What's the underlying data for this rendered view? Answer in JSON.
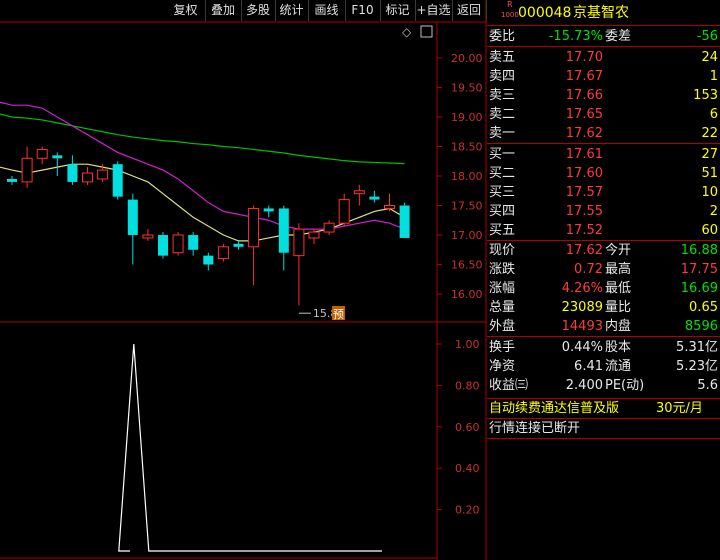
{
  "toolbar": {
    "buttons": [
      "复权",
      "叠加",
      "多股",
      "统计",
      "画线",
      "F10",
      "标记",
      "+自选",
      "返回"
    ]
  },
  "chart": {
    "price_ticks": [
      "20.00",
      "19.50",
      "19.00",
      "18.50",
      "18.00",
      "17.50",
      "17.00",
      "16.50",
      "16.00"
    ],
    "low_label": "15.81",
    "pre_badge": "预",
    "indicator_ticks": [
      "1.00",
      "0.80",
      "0.60",
      "0.40",
      "0.20"
    ],
    "diamond": "◇"
  },
  "chart_data": {
    "type": "candlestick",
    "price_axis": {
      "min": 15.81,
      "max": 20.0,
      "ticks": [
        20.0,
        19.5,
        19.0,
        18.5,
        18.0,
        17.5,
        17.0,
        16.5,
        16.0
      ]
    },
    "candles": [
      {
        "o": 17.95,
        "h": 18.0,
        "l": 17.85,
        "c": 17.9
      },
      {
        "o": 17.9,
        "h": 18.5,
        "l": 17.8,
        "c": 18.3
      },
      {
        "o": 18.3,
        "h": 18.5,
        "l": 18.2,
        "c": 18.45
      },
      {
        "o": 18.35,
        "h": 18.4,
        "l": 18.0,
        "c": 18.3
      },
      {
        "o": 18.2,
        "h": 18.35,
        "l": 17.85,
        "c": 17.9
      },
      {
        "o": 17.9,
        "h": 18.15,
        "l": 17.85,
        "c": 18.05
      },
      {
        "o": 17.95,
        "h": 18.2,
        "l": 17.9,
        "c": 18.1
      },
      {
        "o": 18.2,
        "h": 18.25,
        "l": 17.6,
        "c": 17.65
      },
      {
        "o": 17.6,
        "h": 17.7,
        "l": 16.5,
        "c": 17.0
      },
      {
        "o": 16.95,
        "h": 17.1,
        "l": 16.9,
        "c": 17.0
      },
      {
        "o": 17.0,
        "h": 17.05,
        "l": 16.6,
        "c": 16.65
      },
      {
        "o": 16.7,
        "h": 17.05,
        "l": 16.65,
        "c": 17.0
      },
      {
        "o": 17.0,
        "h": 17.05,
        "l": 16.65,
        "c": 16.75
      },
      {
        "o": 16.65,
        "h": 16.7,
        "l": 16.4,
        "c": 16.5
      },
      {
        "o": 16.6,
        "h": 16.85,
        "l": 16.55,
        "c": 16.8
      },
      {
        "o": 16.85,
        "h": 16.9,
        "l": 16.75,
        "c": 16.8
      },
      {
        "o": 16.8,
        "h": 17.5,
        "l": 16.15,
        "c": 17.45
      },
      {
        "o": 17.45,
        "h": 17.5,
        "l": 17.3,
        "c": 17.4
      },
      {
        "o": 17.45,
        "h": 17.5,
        "l": 16.4,
        "c": 16.7
      },
      {
        "o": 16.65,
        "h": 17.2,
        "l": 15.81,
        "c": 17.1
      },
      {
        "o": 16.95,
        "h": 17.1,
        "l": 16.85,
        "c": 17.05
      },
      {
        "o": 17.05,
        "h": 17.25,
        "l": 17.0,
        "c": 17.2
      },
      {
        "o": 17.2,
        "h": 17.7,
        "l": 17.15,
        "c": 17.6
      },
      {
        "o": 17.7,
        "h": 17.85,
        "l": 17.5,
        "c": 17.75
      },
      {
        "o": 17.65,
        "h": 17.75,
        "l": 17.55,
        "c": 17.6
      },
      {
        "o": 17.45,
        "h": 17.7,
        "l": 17.4,
        "c": 17.5
      },
      {
        "o": 17.5,
        "h": 17.55,
        "l": 16.95,
        "c": 16.95
      }
    ],
    "ma_fast": [
      18.1,
      18.05,
      18.1,
      18.15,
      18.2,
      18.2,
      18.15,
      18.1,
      18.0,
      17.9,
      17.7,
      17.5,
      17.3,
      17.15,
      17.0,
      16.9,
      16.9,
      16.95,
      17.0,
      17.0,
      17.05,
      17.1,
      17.2,
      17.3,
      17.4,
      17.45,
      17.3
    ],
    "ma_mid": [
      19.2,
      19.2,
      19.15,
      19.0,
      18.85,
      18.7,
      18.55,
      18.4,
      18.3,
      18.2,
      18.1,
      17.95,
      17.75,
      17.55,
      17.4,
      17.35,
      17.3,
      17.25,
      17.15,
      17.1,
      17.1,
      17.1,
      17.15,
      17.2,
      17.25,
      17.2,
      17.1
    ],
    "ma_slow": [
      19.0,
      18.98,
      18.95,
      18.9,
      18.85,
      18.8,
      18.75,
      18.7,
      18.66,
      18.63,
      18.6,
      18.58,
      18.55,
      18.53,
      18.5,
      18.48,
      18.45,
      18.42,
      18.39,
      18.35,
      18.32,
      18.29,
      18.26,
      18.24,
      18.23,
      18.22,
      18.21
    ],
    "indicator": {
      "min": 0,
      "max": 1.0,
      "ticks": [
        1.0,
        0.8,
        0.6,
        0.4,
        0.2
      ],
      "values": [
        0,
        0,
        0,
        0,
        0,
        0,
        0,
        0,
        0,
        0,
        0,
        0,
        0,
        0,
        0,
        0,
        0,
        0,
        0,
        0,
        0,
        0,
        0,
        0,
        0,
        0,
        0
      ],
      "spike_index": 8,
      "spike_value": 1.0
    }
  },
  "stock": {
    "code": "000048",
    "name": "京基智农",
    "badge_top": "R",
    "badge_bottom": "1000"
  },
  "order_book": {
    "weibi_label": "委比",
    "weibi_value": "-15.73%",
    "weicha_label": "委差",
    "weicha_value": "-56",
    "asks": [
      {
        "label": "卖五",
        "price": "17.70",
        "vol": "24"
      },
      {
        "label": "卖四",
        "price": "17.67",
        "vol": "1"
      },
      {
        "label": "卖三",
        "price": "17.66",
        "vol": "153"
      },
      {
        "label": "卖二",
        "price": "17.65",
        "vol": "6"
      },
      {
        "label": "卖一",
        "price": "17.62",
        "vol": "22"
      }
    ],
    "bids": [
      {
        "label": "买一",
        "price": "17.61",
        "vol": "27"
      },
      {
        "label": "买二",
        "price": "17.60",
        "vol": "51"
      },
      {
        "label": "买三",
        "price": "17.57",
        "vol": "10"
      },
      {
        "label": "买四",
        "price": "17.55",
        "vol": "2"
      },
      {
        "label": "买五",
        "price": "17.52",
        "vol": "60"
      }
    ]
  },
  "quote": [
    {
      "l1": "现价",
      "v1": "17.62",
      "l2": "今开",
      "v2": "16.88",
      "c1": "red",
      "c2": "green"
    },
    {
      "l1": "涨跌",
      "v1": "0.72",
      "l2": "最高",
      "v2": "17.75",
      "c1": "red",
      "c2": "red"
    },
    {
      "l1": "涨幅",
      "v1": "4.26%",
      "l2": "最低",
      "v2": "16.69",
      "c1": "red",
      "c2": "green"
    },
    {
      "l1": "总量",
      "v1": "23089",
      "l2": "量比",
      "v2": "0.65",
      "c1": "yellow",
      "c2": "yellow"
    },
    {
      "l1": "外盘",
      "v1": "14493",
      "l2": "内盘",
      "v2": "8596",
      "c1": "red",
      "c2": "green"
    }
  ],
  "fundamentals": [
    {
      "l1": "换手",
      "v1": "0.44%",
      "l2": "股本",
      "v2": "5.31亿"
    },
    {
      "l1": "净资",
      "v1": "6.41",
      "l2": "流通",
      "v2": "5.23亿"
    },
    {
      "l1": "收益㈢",
      "v1": "2.400",
      "l2": "PE(动)",
      "v2": "5.6"
    }
  ],
  "promo": {
    "text": "自动续费通达信普及版",
    "price": "30元/月"
  },
  "status": "行情连接已断开"
}
